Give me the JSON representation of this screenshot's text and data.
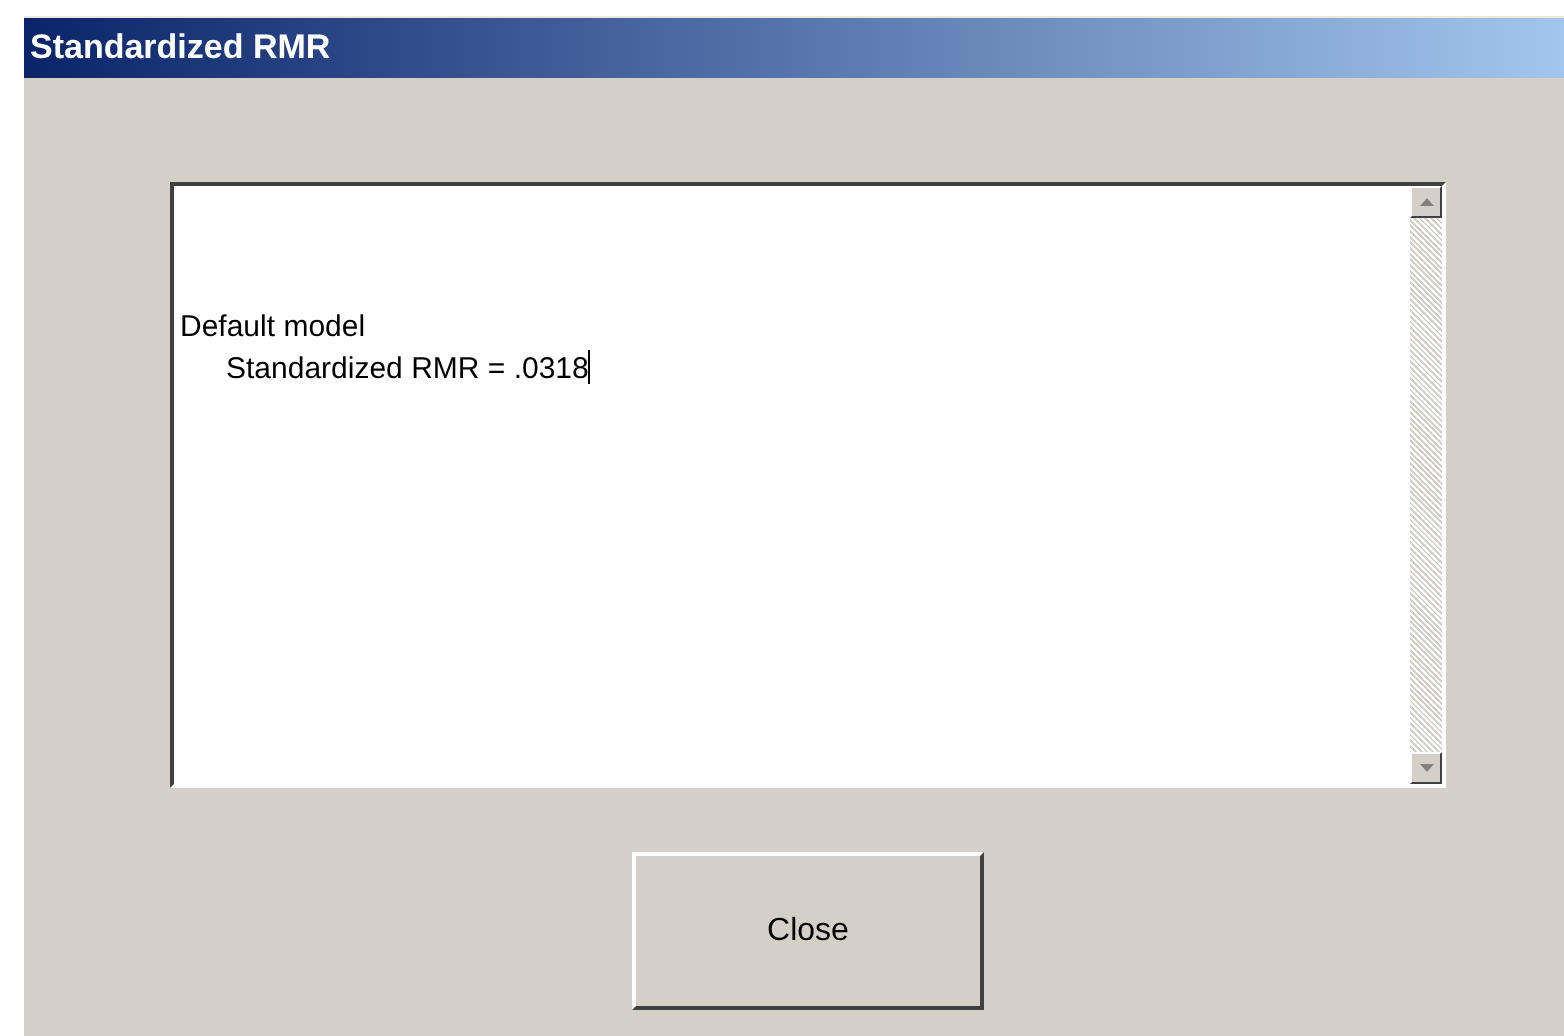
{
  "window": {
    "title": "Standardized RMR"
  },
  "output": {
    "lines": [
      "Default model",
      "Standardized RMR = .0318"
    ],
    "cursor_visible": true
  },
  "buttons": [
    "Close"
  ]
}
